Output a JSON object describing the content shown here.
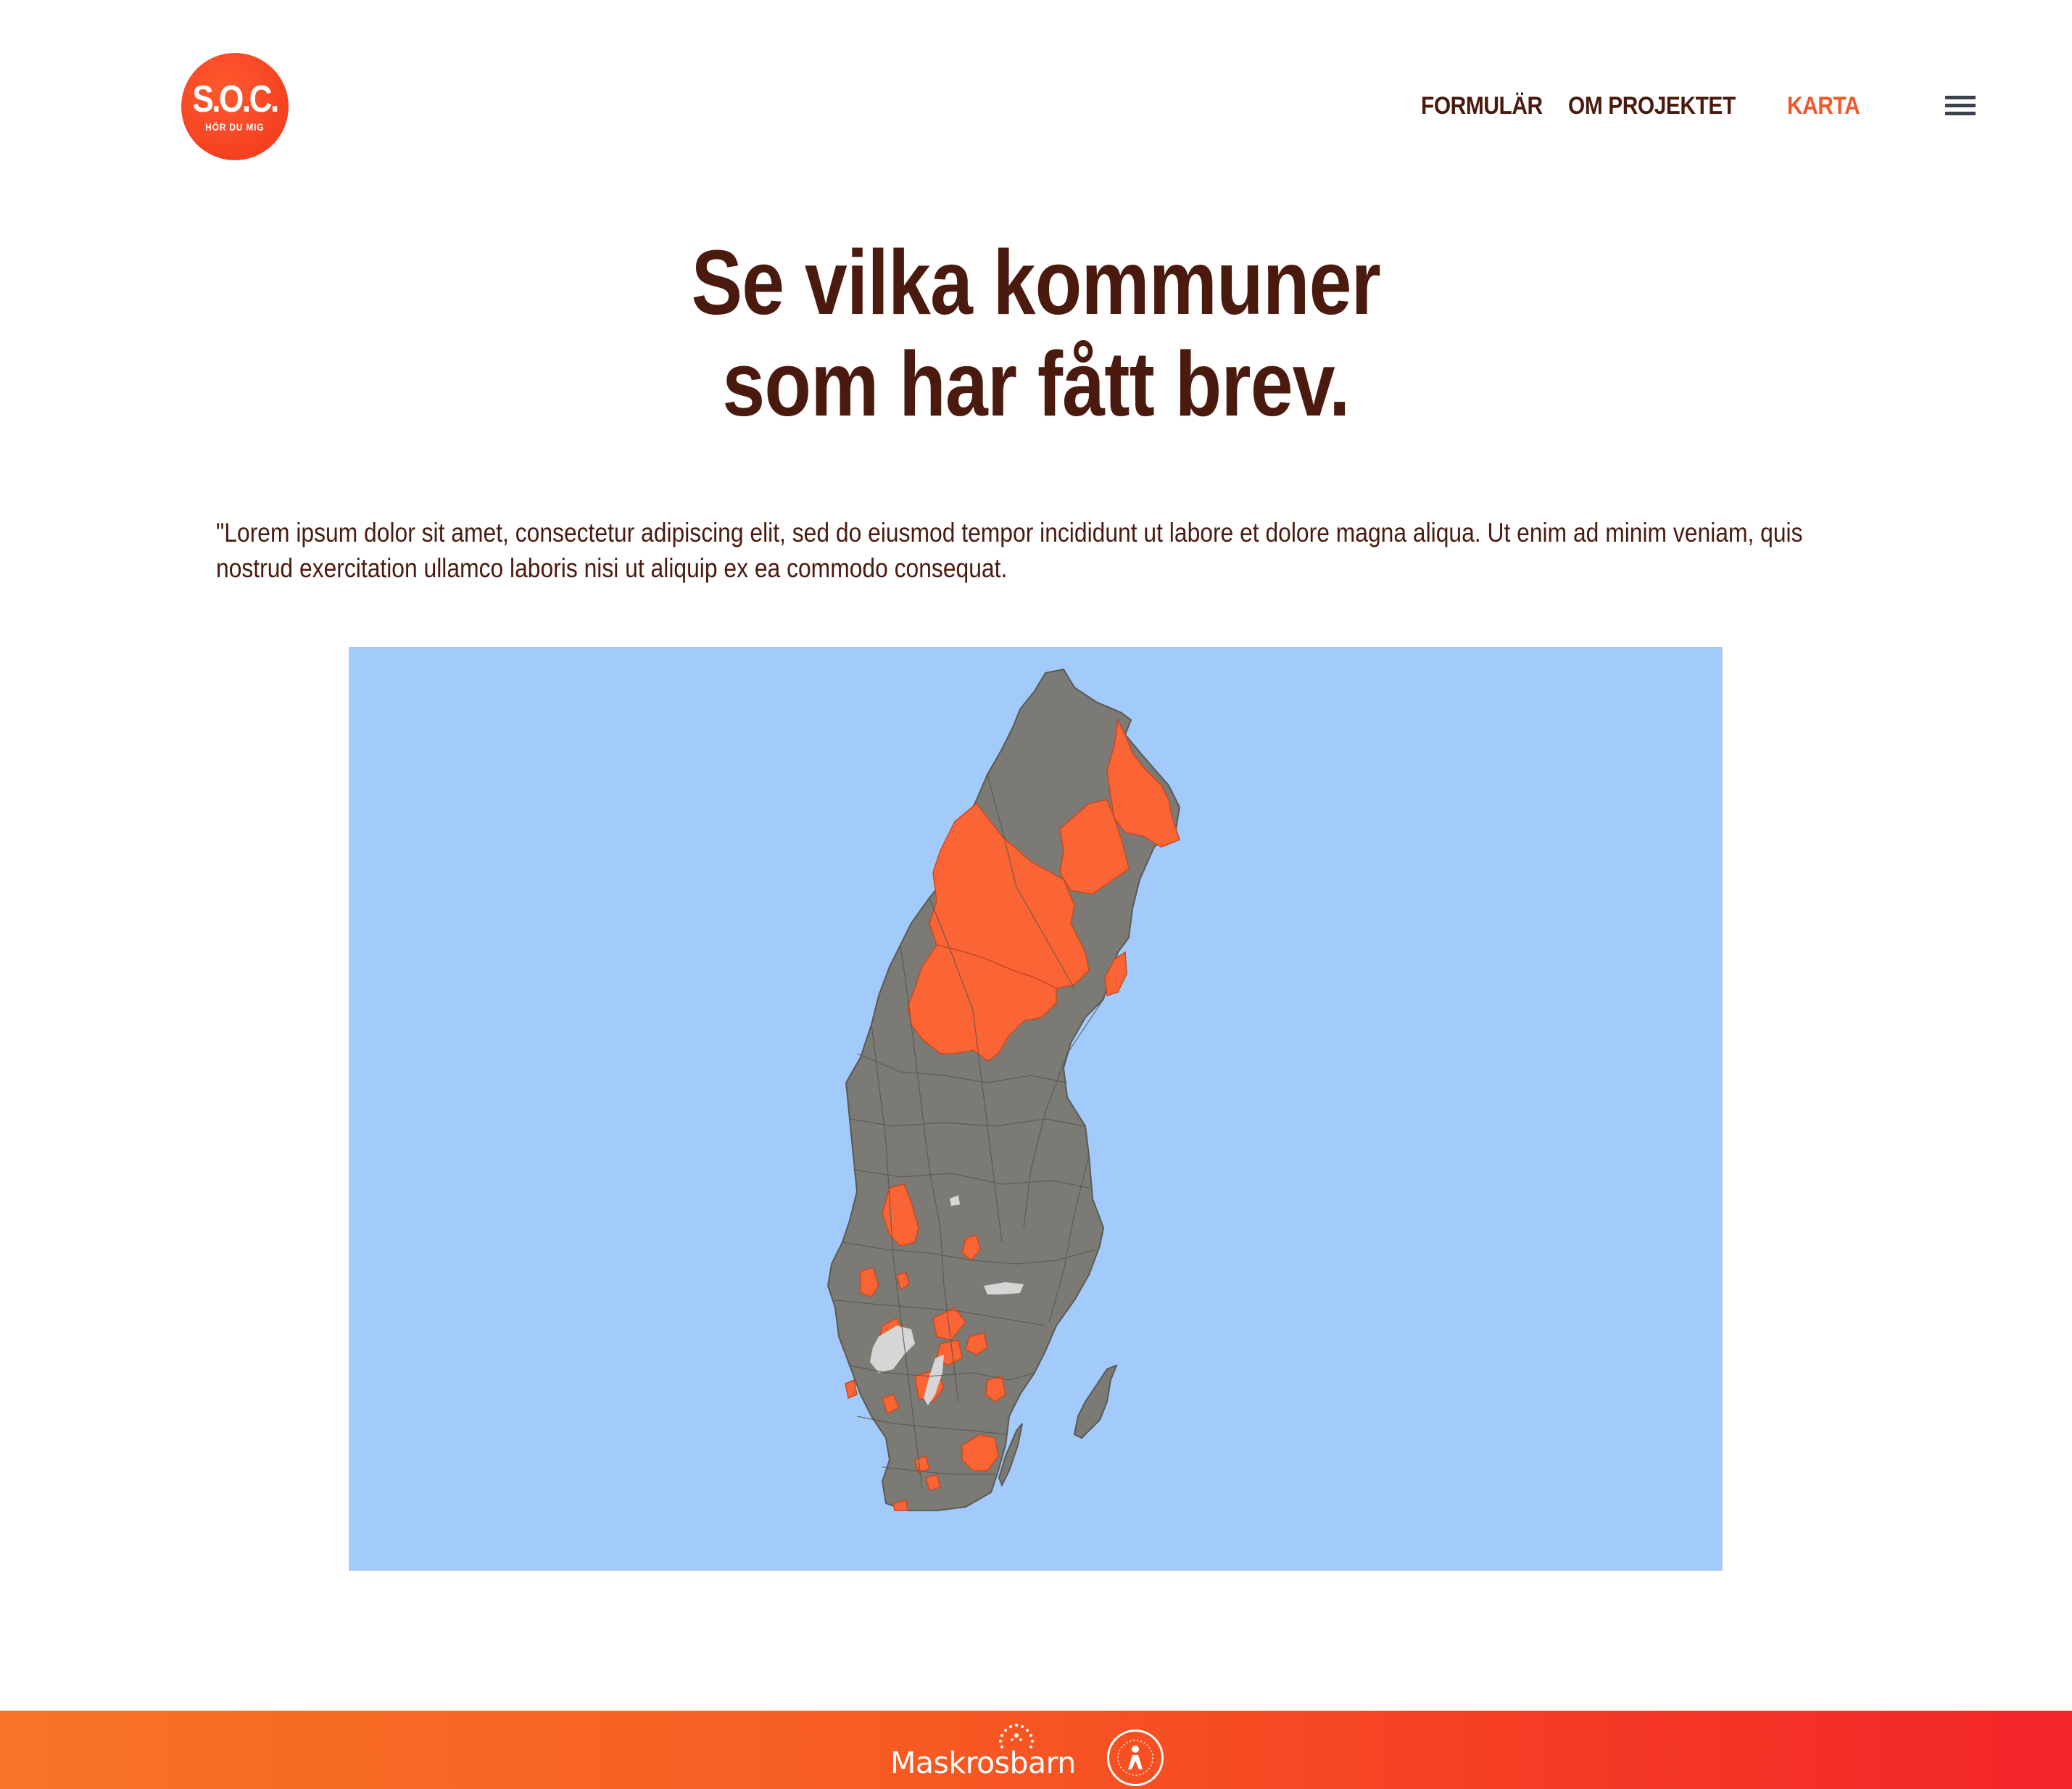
{
  "header": {
    "logo_text": "S.O.C.",
    "logo_subtext": "HÖR DU MIG",
    "nav": [
      {
        "label": "FORMULÄR",
        "active": false
      },
      {
        "label": "OM PROJEKTET",
        "active": false
      },
      {
        "label": "KARTA",
        "active": true
      }
    ],
    "menu_icon": "hamburger-icon"
  },
  "hero": {
    "title_line1": "Se vilka kommuner",
    "title_line2": "som har fått brev."
  },
  "intro_text": "\"Lorem ipsum dolor sit amet, consectetur adipiscing elit, sed do eiusmod tempor incididunt ut labore et dolore magna aliqua. Ut enim ad minim veniam, quis nostrud exercitation ullamco laboris nisi ut aliquip ex ea commodo consequat.",
  "map": {
    "region": "Sweden municipalities",
    "colors": {
      "water": "#a2cbfc",
      "no_letter": "#7b7a74",
      "received_letter": "#fb6536",
      "lakes": "#d6d6d6",
      "borders": "#4b4a45"
    }
  },
  "footer": {
    "brand": "Maskrosbarn",
    "seal_icon": "partner-seal-icon",
    "colors": {
      "gradient_start": "#f77426",
      "gradient_end": "#f3242a"
    }
  }
}
